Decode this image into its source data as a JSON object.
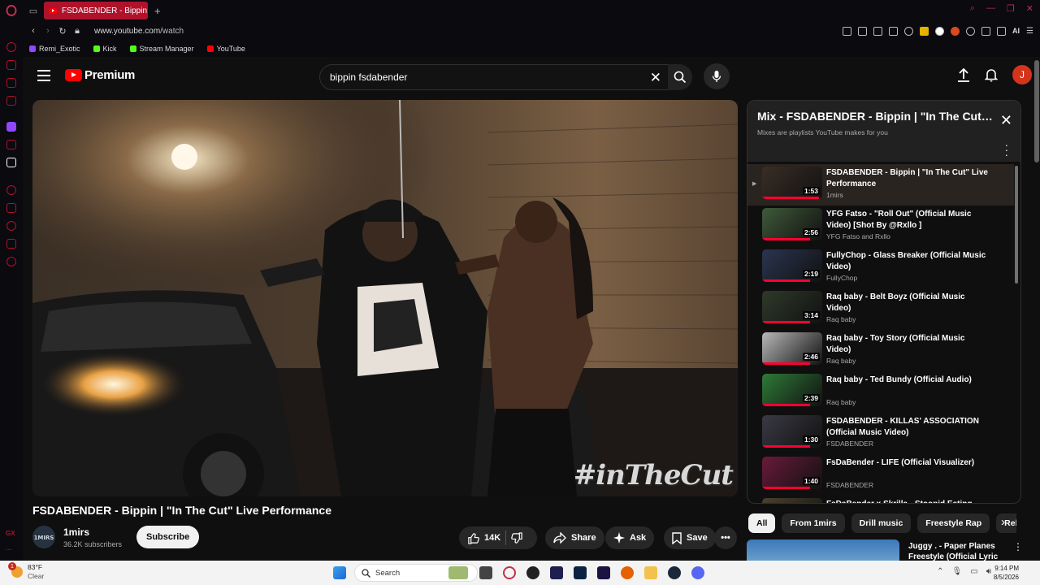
{
  "browser": {
    "tab_title": "FSDABENDER - Bippin | \"In",
    "url_host": "www.youtube.com",
    "url_path": "/watch",
    "ai_label": "AI",
    "bookmarks": [
      {
        "label": "Remi_Exotic",
        "color": "#9146ff"
      },
      {
        "label": "Kick",
        "color": "#53fc18"
      },
      {
        "label": "Stream Manager",
        "color": "#53fc18"
      },
      {
        "label": "YouTube",
        "color": "#ff0000"
      }
    ],
    "sidebar_gx": "GX"
  },
  "header": {
    "logo_text": "Premium",
    "search_value": "bippin fsdabender",
    "avatar_letter": "J"
  },
  "player": {
    "watermark": "#inTheCut"
  },
  "video": {
    "title": "FSDABENDER - Bippin | \"In The Cut\" Live Performance",
    "channel": "1mirs",
    "subscribers": "36.2K subscribers",
    "subscribe_label": "Subscribe",
    "likes": "14K",
    "share_label": "Share",
    "ask_label": "Ask",
    "save_label": "Save"
  },
  "mix": {
    "title": "Mix - FSDABENDER - Bippin | \"In The Cut\" Live Performance",
    "subtitle": "Mixes are playlists YouTube makes for you",
    "items": [
      {
        "title": "FSDABENDER - Bippin | \"In The Cut\" Live Performance",
        "channel": "1mirs",
        "duration": "1:53"
      },
      {
        "title": "YFG Fatso - \"Roll Out\" (Official Music Video) [Shot By @Rxllo ]",
        "channel": "YFG Fatso and Rxllo",
        "duration": "2:56"
      },
      {
        "title": "FullyChop - Glass Breaker (Official Music Video)",
        "channel": "FullyChop",
        "duration": "2:19"
      },
      {
        "title": "Raq baby - Belt Boyz (Official Music Video)",
        "channel": "Raq baby",
        "duration": "3:14"
      },
      {
        "title": "Raq baby - Toy Story (Official Music Video)",
        "channel": "Raq baby",
        "duration": "2:46"
      },
      {
        "title": "Raq baby - Ted Bundy (Official Audio)",
        "channel": "Raq baby",
        "duration": "2:39"
      },
      {
        "title": "FSDABENDER - KILLAS' ASSOCIATION (Official Music Video)",
        "channel": "FSDABENDER",
        "duration": "1:30"
      },
      {
        "title": "FsDaBender - LIFE (Official Visualizer)",
        "channel": "FSDABENDER",
        "duration": "1:40"
      },
      {
        "title": "FsDaBender x Skrilla - Stoopid Eating",
        "channel": "",
        "duration": ""
      }
    ]
  },
  "chips": [
    "All",
    "From 1mirs",
    "Drill music",
    "Freestyle Rap",
    "Rela"
  ],
  "recommendation": {
    "title": "Juggy . - Paper Planes Freestyle (Official Lyric ..."
  },
  "taskbar": {
    "temp": "83°F",
    "condition": "Clear",
    "notif_count": "1",
    "search_label": "Search",
    "time": "9:14 PM",
    "date": "8/5/2026"
  },
  "colors": {
    "opera_red": "#b0122b",
    "yt_red": "#ff0000",
    "bg": "#0f0f0f"
  }
}
